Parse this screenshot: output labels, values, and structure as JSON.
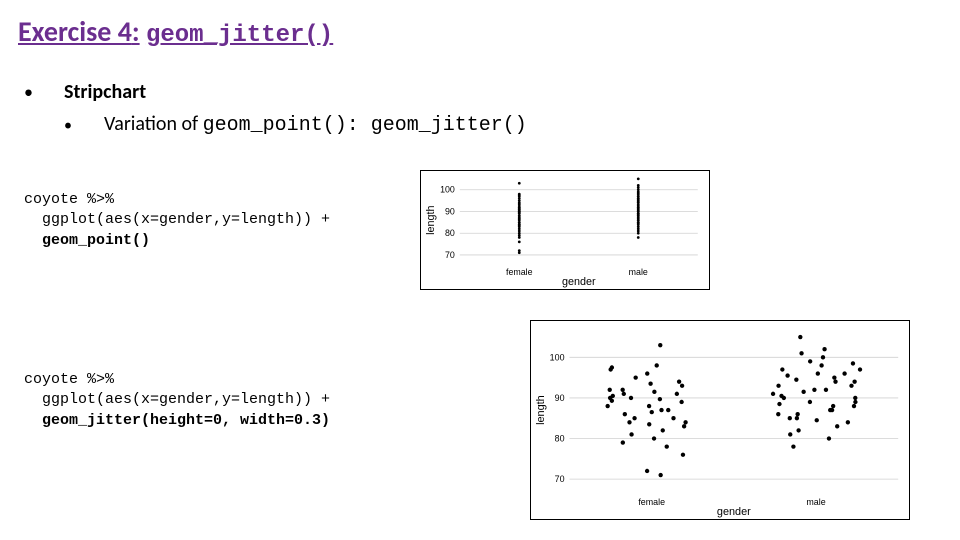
{
  "title": {
    "exercise": "Exercise 4",
    "colon": ":",
    "func": "geom_jitter()"
  },
  "bullets": {
    "l1": "Stripchart",
    "l2_pre": "Variation of ",
    "l2_code": "geom_point(): geom_jitter()"
  },
  "code1": {
    "line1": "coyote %>%",
    "line2": "  ggplot(aes(x=gender,y=length)) +",
    "line3": "  geom_point()"
  },
  "code2": {
    "line1": "coyote %>%",
    "line2": "  ggplot(aes(x=gender,y=length)) +",
    "line3": "  geom_jitter(height=0, width=0.3)"
  },
  "chart_data": [
    {
      "type": "scatter",
      "title": "",
      "xlabel": "gender",
      "ylabel": "length",
      "xtype": "categorical",
      "categories": [
        "female",
        "male"
      ],
      "yticks": [
        70,
        80,
        90,
        100
      ],
      "ylim": [
        67,
        105
      ],
      "series": [
        {
          "name": "female",
          "x": 0,
          "values": [
            71,
            72,
            76,
            78,
            79,
            80,
            81,
            82,
            83,
            83.5,
            84,
            84,
            85,
            85,
            86,
            86.5,
            87,
            87,
            88,
            88,
            89,
            89.3,
            89.7,
            90,
            90,
            90.5,
            91,
            91,
            91.5,
            92,
            92,
            93,
            93.5,
            94,
            95,
            96,
            97,
            97.5,
            98,
            103
          ]
        },
        {
          "name": "male",
          "x": 1,
          "values": [
            78,
            80,
            81,
            82,
            83,
            84,
            84.5,
            85,
            85,
            86,
            86,
            87,
            87,
            88,
            88,
            88.5,
            89,
            89,
            90,
            90,
            90.5,
            91,
            91.5,
            92,
            92,
            93,
            93,
            94,
            94,
            94.5,
            95,
            95.5,
            96,
            96,
            97,
            97,
            98,
            98.5,
            99,
            100,
            101,
            102,
            105
          ]
        }
      ]
    },
    {
      "type": "scatter",
      "title": "",
      "xlabel": "gender",
      "ylabel": "length",
      "xtype": "categorical",
      "categories": [
        "female",
        "male"
      ],
      "yticks": [
        70,
        80,
        90,
        100
      ],
      "ylim": [
        67,
        107
      ],
      "jitter_width": 0.3,
      "series": [
        {
          "name": "female",
          "x": 0,
          "values": [
            71,
            72,
            76,
            78,
            79,
            80,
            81,
            82,
            83,
            83.5,
            84,
            84,
            85,
            85,
            86,
            86.5,
            87,
            87,
            88,
            88,
            89,
            89.3,
            89.7,
            90,
            90,
            90.5,
            91,
            91,
            91.5,
            92,
            92,
            93,
            93.5,
            94,
            95,
            96,
            97,
            97.5,
            98,
            103
          ]
        },
        {
          "name": "male",
          "x": 1,
          "values": [
            78,
            80,
            81,
            82,
            83,
            84,
            84.5,
            85,
            85,
            86,
            86,
            87,
            87,
            88,
            88,
            88.5,
            89,
            89,
            90,
            90,
            90.5,
            91,
            91.5,
            92,
            92,
            93,
            93,
            94,
            94,
            94.5,
            95,
            95.5,
            96,
            96,
            97,
            97,
            98,
            98.5,
            99,
            100,
            101,
            102,
            105
          ]
        }
      ]
    }
  ]
}
